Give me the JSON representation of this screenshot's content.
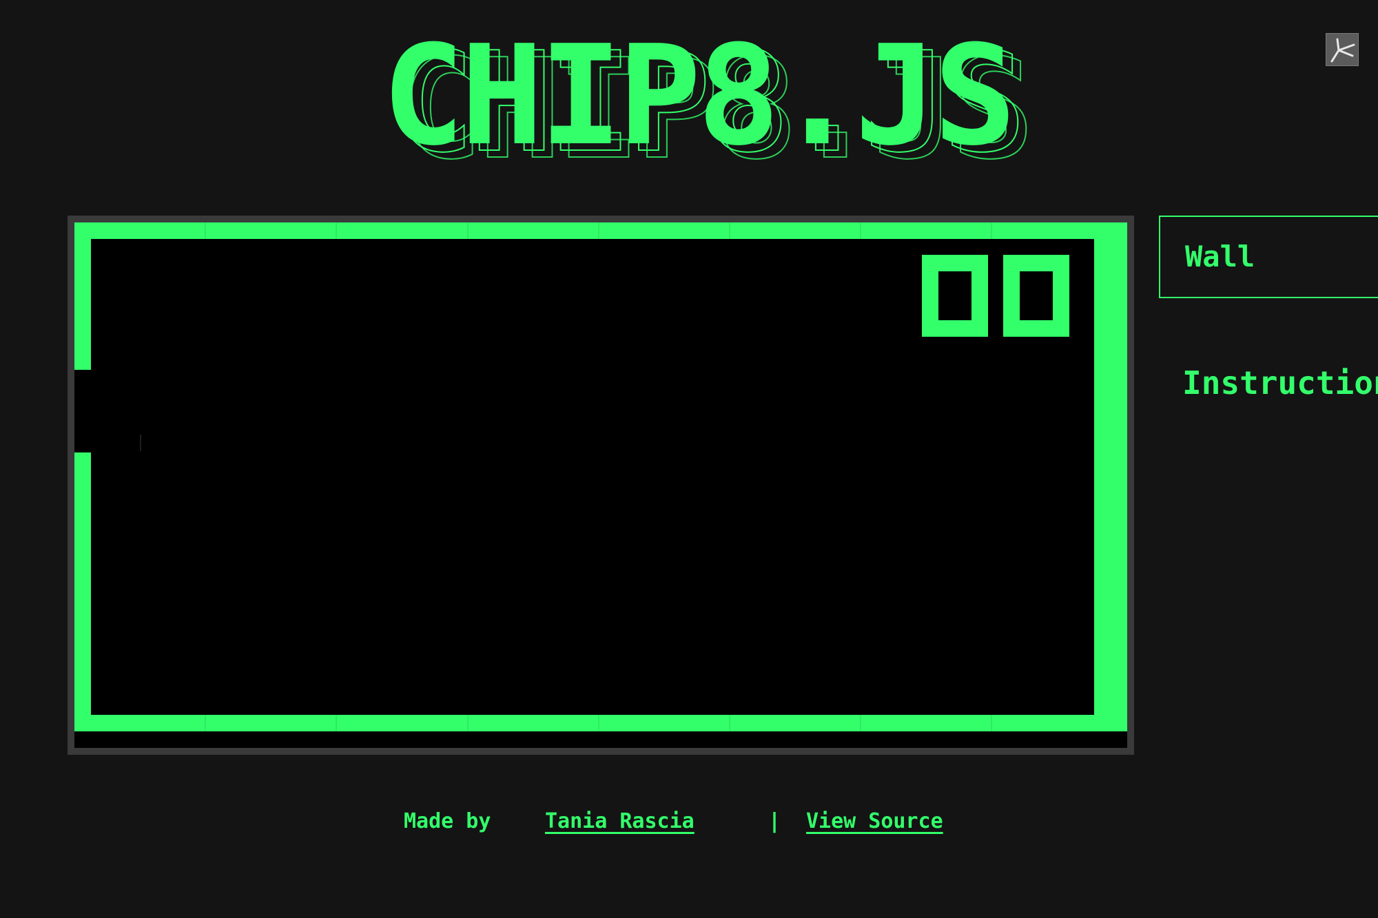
{
  "app": {
    "title": "CHIP8.JS"
  },
  "colors": {
    "accent": "#33ff6b",
    "background": "#141414",
    "screen_background": "#000000",
    "screen_frame": "#3a3a3a"
  },
  "toolbar": {
    "icon": "cursor-icon"
  },
  "emulator": {
    "score": "00"
  },
  "sidebar": {
    "rom_select_value": "Wall",
    "heading": "Instructions"
  },
  "footer": {
    "made_by": "Made by",
    "author": "Tania Rascia",
    "separator": "|",
    "source": "View Source"
  }
}
